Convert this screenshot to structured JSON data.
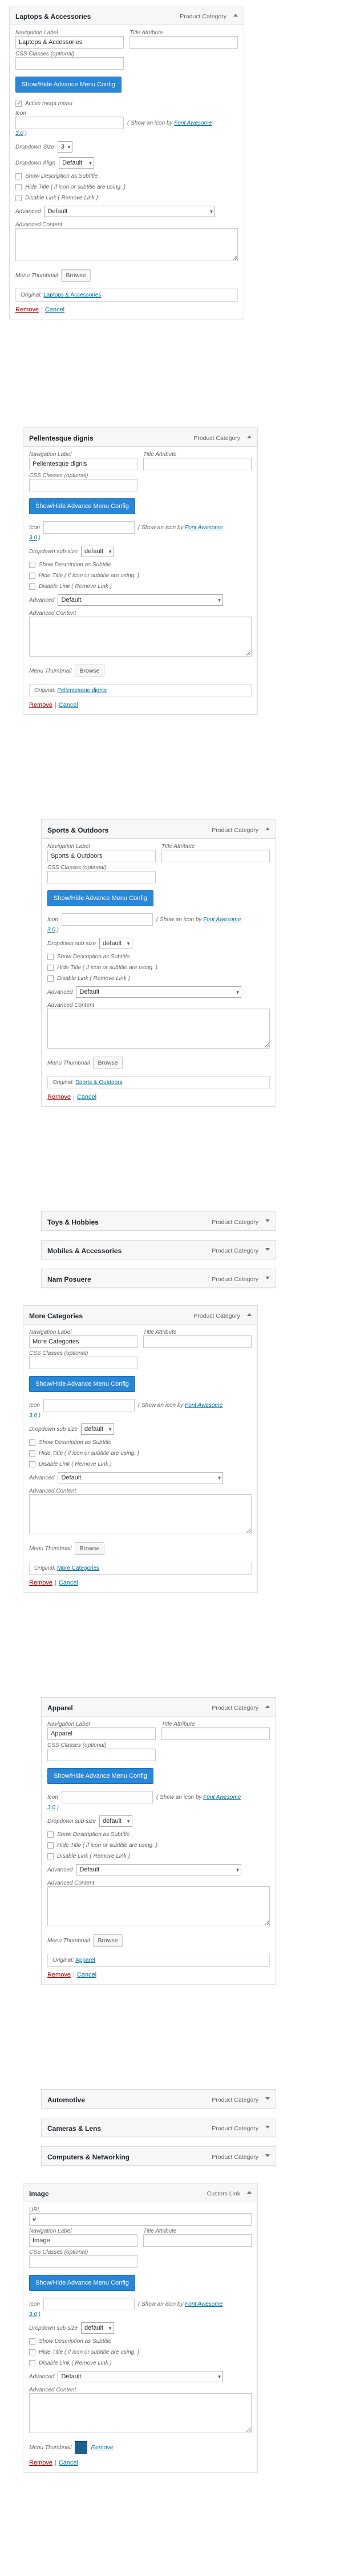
{
  "common": {
    "nav_label": "Navigation Label",
    "title_attr": "Title Attribute",
    "css_classes": "CSS Classes (optional)",
    "adv_btn": "Show/Hide Advance Menu Config",
    "icon": "Icon",
    "icon_hint_pre": "( Show an icon by ",
    "icon_hint_link": "Font Awesome",
    "icon_hint_ver": "3.0",
    "icon_hint_post": " )",
    "dropdown_size": "Dropdown Size",
    "dropdown_sub_size": "Dropdown sub size",
    "dropdown_align": "Dropdown Align",
    "show_desc": "Show Description as Subtitle",
    "hide_title": "Hide Title ( if icon or subtitle are using. )",
    "disable_link": "Disable Link ( Remove Link )",
    "advanced": "Advanced",
    "advanced_content": "Advanced Content",
    "menu_thumbnail": "Menu Thumbnail",
    "browse": "Browse",
    "remove_thumb": "Remove",
    "original": "Original:",
    "remove": "Remove",
    "sep": "|",
    "cancel": "Cancel",
    "url": "URL",
    "active_mega_menu": "Active mega menu"
  },
  "items": [
    {
      "title": "Laptops & Accessories",
      "type": "Product Category",
      "nav_value": "Laptops & Accessories",
      "dropdown_size": "3",
      "dropdown_align": "Default",
      "advanced": "Default",
      "original_link": "Laptops & Accessories"
    },
    {
      "title": "Pellentesque dignis",
      "type": "Product Category",
      "nav_value": "Pellentesque dignis",
      "dropdown_sub_size": "default",
      "advanced": "Default",
      "original_link": "Pellentesque dignis"
    },
    {
      "title": "Sports & Outdoors",
      "type": "Product Category",
      "nav_value": "Sports & Outdoors",
      "dropdown_sub_size": "default",
      "advanced": "Default",
      "original_link": "Sports & Outdoors"
    },
    {
      "title": "Toys & Hobbies",
      "type": "Product Category"
    },
    {
      "title": "Mobiles & Accessories",
      "type": "Product Category"
    },
    {
      "title": "Nam Posuere",
      "type": "Product Category"
    },
    {
      "title": "More Categories",
      "type": "Product Category",
      "nav_value": "More Categories",
      "dropdown_sub_size": "default",
      "advanced": "Default",
      "original_link": "More Categories"
    },
    {
      "title": "Apparel",
      "type": "Product Category",
      "nav_value": "Apparel",
      "dropdown_sub_size": "default",
      "advanced": "Default",
      "original_link": "Apparel"
    },
    {
      "title": "Automotive",
      "type": "Product Category"
    },
    {
      "title": "Cameras & Lens",
      "type": "Product Category"
    },
    {
      "title": "Computers & Networking",
      "type": "Product Category"
    },
    {
      "title": "Image",
      "type": "Custom Link",
      "url_value": "#",
      "nav_value": "Image",
      "dropdown_sub_size": "default",
      "advanced": "Default"
    }
  ]
}
